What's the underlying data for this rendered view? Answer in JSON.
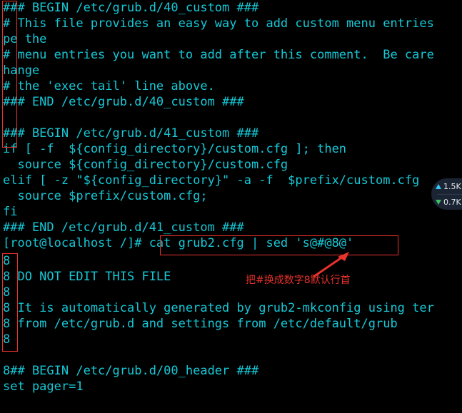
{
  "terminal": {
    "foreground_color": "#16c8d6",
    "background_color": "#000000",
    "lines": [
      {
        "text": "### BEGIN /etc/grub.d/40_custom ###"
      },
      {
        "text": "# This file provides an easy way to add custom menu entries"
      },
      {
        "text": "pe the"
      },
      {
        "text": "# menu entries you want to add after this comment.  Be care"
      },
      {
        "text": "hange"
      },
      {
        "text": "# the 'exec tail' line above."
      },
      {
        "text": "### END /etc/grub.d/40_custom ###"
      },
      {
        "text": ""
      },
      {
        "text": "### BEGIN /etc/grub.d/41_custom ###"
      },
      {
        "text": "if [ -f  ${config_directory}/custom.cfg ]; then"
      },
      {
        "text": "  source ${config_directory}/custom.cfg"
      },
      {
        "text": "elif [ -z \"${config_directory}\" -a -f  $prefix/custom.cfg"
      },
      {
        "text": "  source $prefix/custom.cfg;"
      },
      {
        "text": "fi"
      },
      {
        "text": "### END /etc/grub.d/41_custom ###"
      },
      {
        "text": "[root@localhost /]# cat grub2.cfg | sed 's@#@8@'"
      },
      {
        "text": "8"
      },
      {
        "text": "8 DO NOT EDIT THIS FILE"
      },
      {
        "text": "8"
      },
      {
        "text": "8 It is automatically generated by grub2-mkconfig using ter"
      },
      {
        "text": "8 from /etc/grub.d and settings from /etc/default/grub"
      },
      {
        "text": "8"
      },
      {
        "text": ""
      },
      {
        "text": "8## BEGIN /etc/grub.d/00_header ###"
      },
      {
        "text": "set pager=1"
      }
    ],
    "prompt": "[root@localhost /]#",
    "command": "cat grub2.cfg | sed 's@#@8@'"
  },
  "annotations": {
    "color": "#e8322c",
    "note_text": "把#换成数字8默认行首",
    "box_left_label": "hash-column-highlight",
    "box_command_label": "command-highlight",
    "box_eight_label": "eight-column-highlight"
  },
  "net_widget": {
    "upload": "1.5K",
    "download": "0.7K",
    "upload_icon": "arrow-up-icon",
    "download_icon": "arrow-down-icon",
    "upload_color": "#36c6f4",
    "download_color": "#3fbf63"
  }
}
